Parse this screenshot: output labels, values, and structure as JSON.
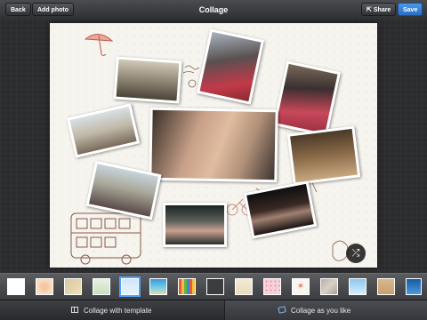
{
  "toolbar": {
    "back_label": "Back",
    "add_photo_label": "Add photo",
    "title": "Collage",
    "share_label": "Share",
    "save_label": "Save"
  },
  "bottom_tabs": [
    {
      "label": "Collage with template",
      "icon": "template-grid-icon",
      "active": false
    },
    {
      "label": "Collage as you like",
      "icon": "freeform-collage-icon",
      "active": true
    }
  ],
  "colors": {
    "accent": "#3a8ee0",
    "toolbar": "#3c3e42",
    "canvas": "#f6f4ee"
  },
  "canvas": {
    "shuffle_icon": "shuffle-icon",
    "photo_count": 10,
    "stickers": [
      "umbrella-doodle",
      "bus-doodle",
      "bicycle-doodle",
      "cat-doodle",
      "text-scribble"
    ]
  },
  "backgrounds": [
    {
      "name": "white",
      "selected": false
    },
    {
      "name": "peach-floral",
      "selected": false
    },
    {
      "name": "sandy-beach",
      "selected": false
    },
    {
      "name": "mint-paper",
      "selected": false
    },
    {
      "name": "sky-blue",
      "selected": true
    },
    {
      "name": "tropical-sea",
      "selected": false
    },
    {
      "name": "color-stripes",
      "selected": false
    },
    {
      "name": "dark-charcoal",
      "selected": false
    },
    {
      "name": "cream-linen",
      "selected": false
    },
    {
      "name": "pink-polka",
      "selected": false
    },
    {
      "name": "white-starfish",
      "selected": false
    },
    {
      "name": "gray-stone",
      "selected": false
    },
    {
      "name": "light-blue-sky",
      "selected": false
    },
    {
      "name": "kraft-paper",
      "selected": false
    },
    {
      "name": "blue-ocean",
      "selected": false
    }
  ]
}
